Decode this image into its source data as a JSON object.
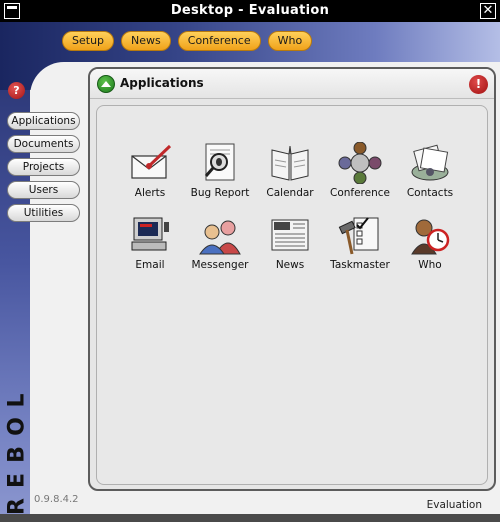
{
  "window": {
    "title": "Desktop - Evaluation",
    "close_glyph": "✕"
  },
  "topnav": [
    "Setup",
    "News",
    "Conference",
    "Who"
  ],
  "help_glyph": "?",
  "sidenav": [
    "Applications",
    "Documents",
    "Projects",
    "Users",
    "Utilities"
  ],
  "logo_letters": [
    "R",
    "E",
    "B",
    "O",
    "L"
  ],
  "version": "0.9.8.4.2",
  "panel": {
    "title": "Applications",
    "alert_glyph": "!"
  },
  "apps": [
    {
      "label": "Alerts",
      "icon": "alerts-icon"
    },
    {
      "label": "Bug Report",
      "icon": "bug-report-icon"
    },
    {
      "label": "Calendar",
      "icon": "calendar-icon"
    },
    {
      "label": "Conference",
      "icon": "conference-icon"
    },
    {
      "label": "Contacts",
      "icon": "contacts-icon"
    },
    {
      "label": "Email",
      "icon": "email-icon"
    },
    {
      "label": "Messenger",
      "icon": "messenger-icon"
    },
    {
      "label": "News",
      "icon": "news-icon"
    },
    {
      "label": "Taskmaster",
      "icon": "taskmaster-icon"
    },
    {
      "label": "Who",
      "icon": "who-icon"
    }
  ],
  "status": "Evaluation"
}
